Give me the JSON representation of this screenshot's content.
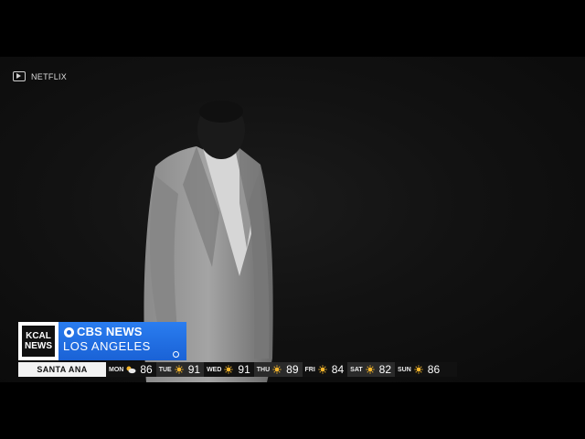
{
  "credit": {
    "icon": "video-camera-icon",
    "source": "NETFLIX"
  },
  "bug": {
    "kcal_line1": "KCAL",
    "kcal_line2": "NEWS",
    "network": "CBS NEWS",
    "market": "LOS ANGELES",
    "colors": {
      "cbs_blue": "#1a62d6",
      "kcal_bg": "#111111"
    }
  },
  "weather": {
    "city": "SANTA ANA",
    "days": [
      {
        "label": "MON",
        "icon": "partly-cloudy-icon",
        "temp": "86"
      },
      {
        "label": "TUE",
        "icon": "sun-icon",
        "temp": "91"
      },
      {
        "label": "WED",
        "icon": "sun-icon",
        "temp": "91"
      },
      {
        "label": "THU",
        "icon": "sun-icon",
        "temp": "89"
      },
      {
        "label": "FRI",
        "icon": "sun-icon",
        "temp": "84"
      },
      {
        "label": "SAT",
        "icon": "sun-icon",
        "temp": "82"
      },
      {
        "label": "SUN",
        "icon": "sun-icon",
        "temp": "86"
      }
    ]
  }
}
